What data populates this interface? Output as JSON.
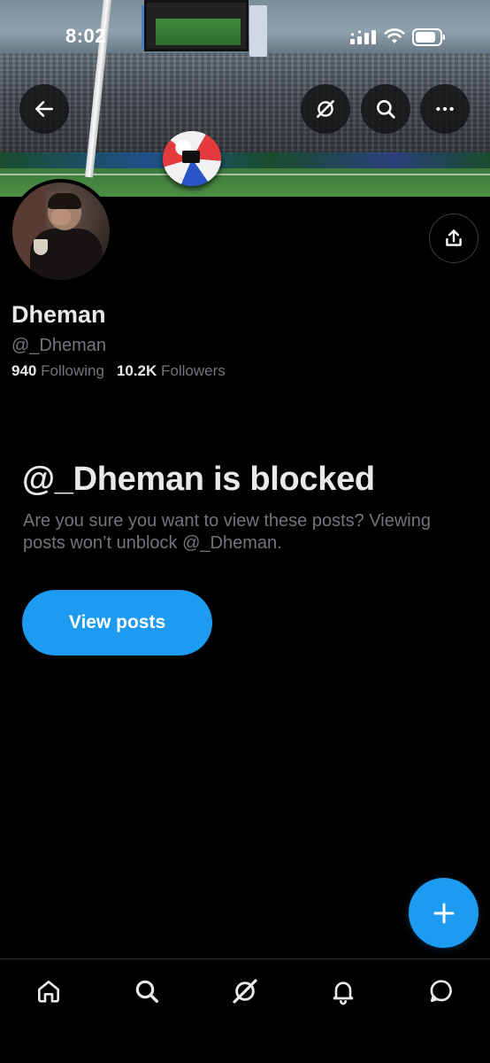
{
  "status_bar": {
    "time": "8:02"
  },
  "profile": {
    "display_name": "Dheman",
    "handle": "@_Dheman",
    "following_count": "940",
    "following_label": "Following",
    "followers_count": "10.2K",
    "followers_label": "Followers"
  },
  "blocked": {
    "title": "@_Dheman is blocked",
    "description": "Are you sure you want to view these posts? Viewing posts won’t unblock @_Dheman.",
    "button_label": "View posts"
  },
  "header_buttons": [
    "back-arrow-icon",
    "grok-icon",
    "search-icon",
    "more-icon"
  ],
  "bottom_nav": [
    "home-icon",
    "search-icon",
    "grok-icon",
    "notifications-icon",
    "messages-icon"
  ],
  "colors": {
    "accent": "#1d9bf0",
    "background": "#000000",
    "primary_text": "#e7e9ea",
    "secondary_text": "#71767b"
  }
}
